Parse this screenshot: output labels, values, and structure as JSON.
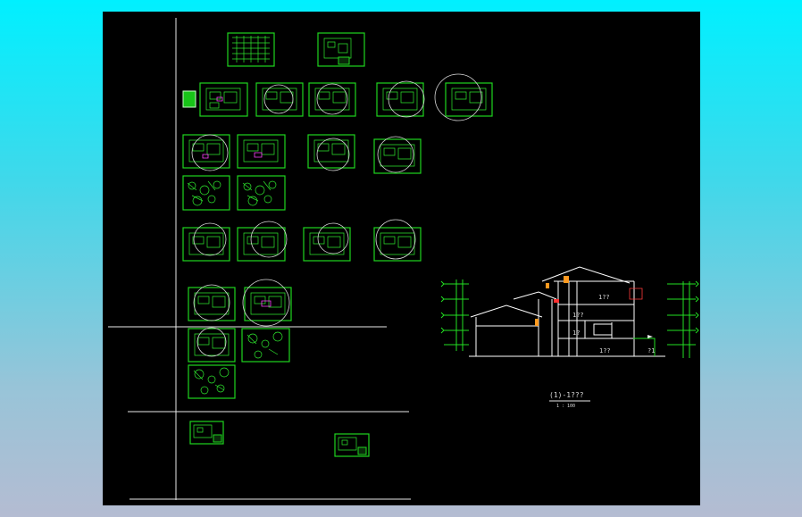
{
  "drawing": {
    "background_color": "#000000",
    "line_color": "#1fd41f",
    "section_title": "(1)-1???",
    "section_scale": "1 : 100",
    "room_labels": [
      "1??",
      "1??",
      "1?",
      "1??",
      "?1"
    ]
  }
}
